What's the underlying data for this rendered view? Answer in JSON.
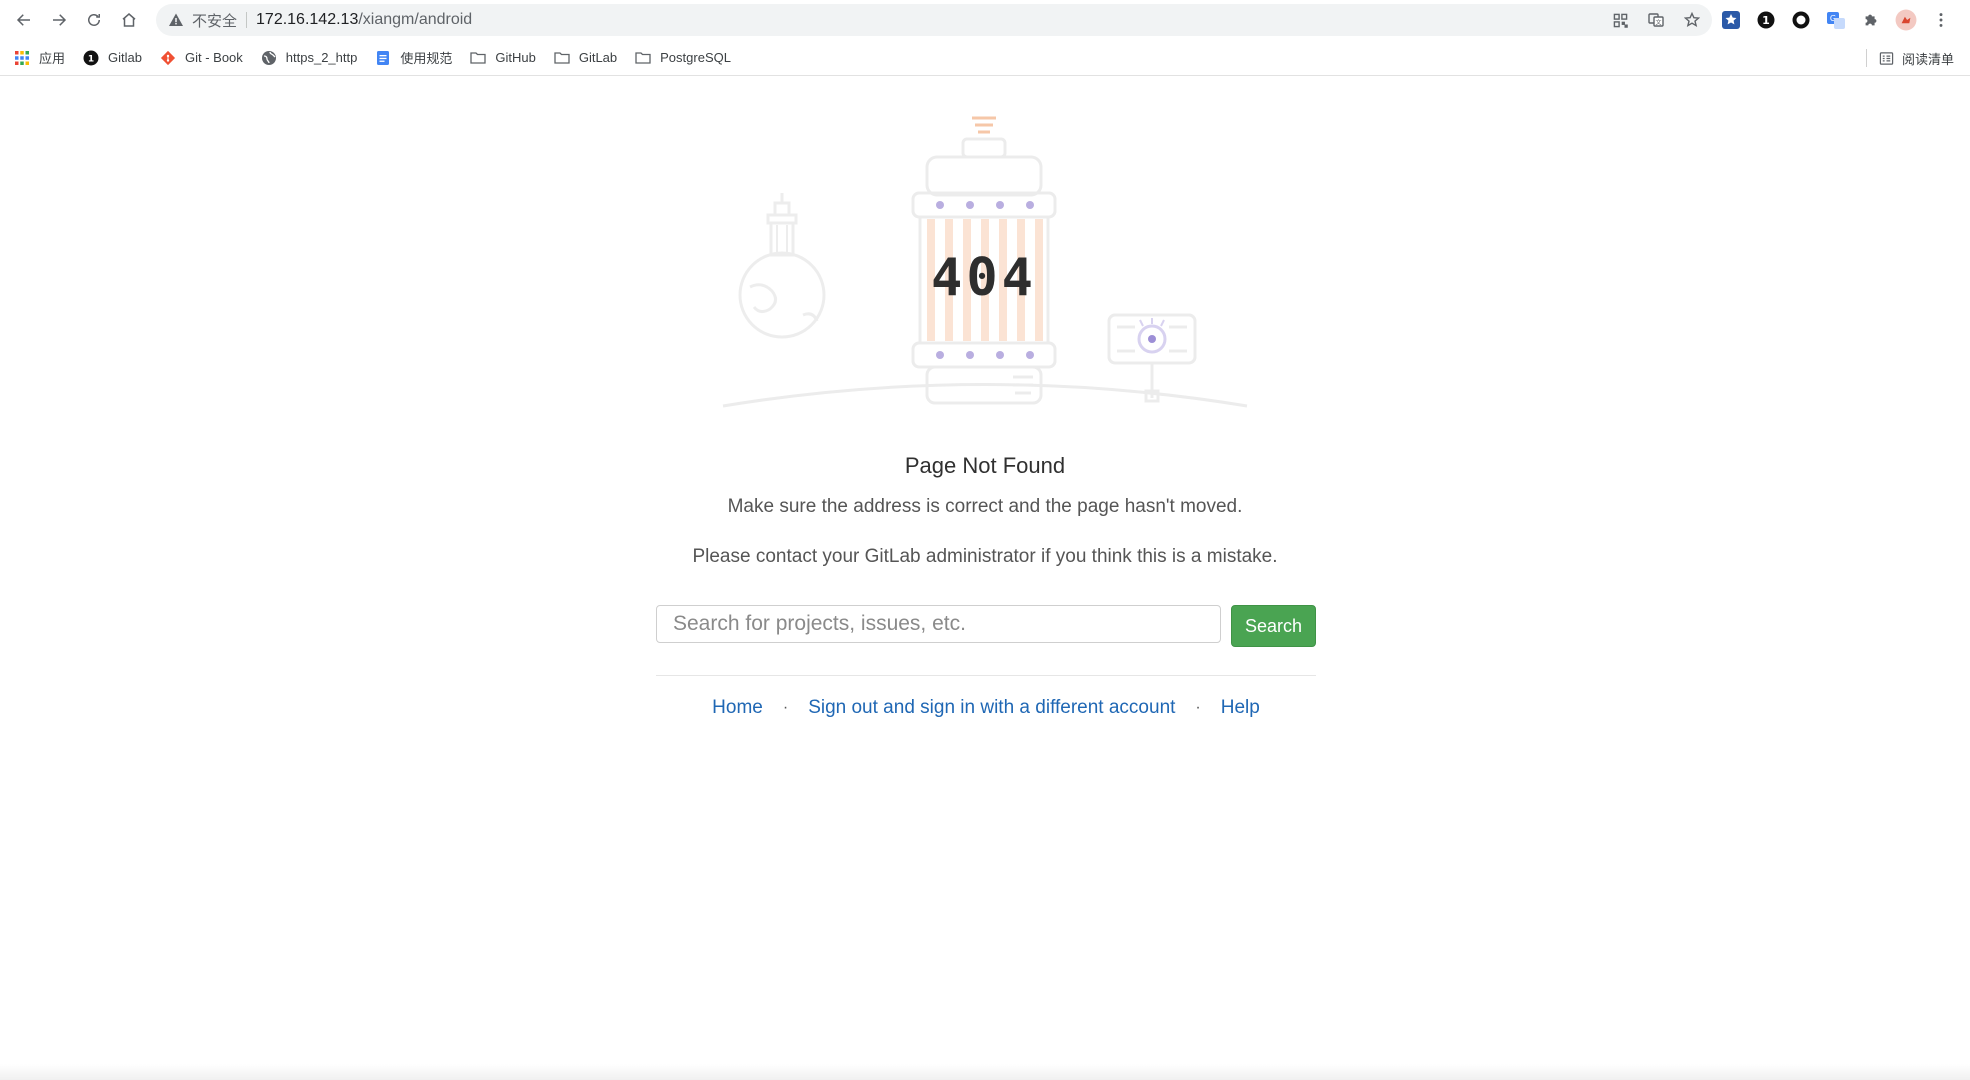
{
  "browser": {
    "insecure_label": "不安全",
    "url_host": "172.16.142.13",
    "url_path": "/xiangm/android",
    "bookmarks": [
      {
        "label": "应用",
        "icon": "apps-grid-icon"
      },
      {
        "label": "Gitlab",
        "icon": "number-one-badge-icon"
      },
      {
        "label": "Git - Book",
        "icon": "git-logo-icon"
      },
      {
        "label": "https_2_http",
        "icon": "globe-icon"
      },
      {
        "label": "使用规范",
        "icon": "doc-icon"
      },
      {
        "label": "GitHub",
        "icon": "folder-icon"
      },
      {
        "label": "GitLab",
        "icon": "folder-icon"
      },
      {
        "label": "PostgreSQL",
        "icon": "folder-icon"
      }
    ],
    "reading_list_label": "阅读清单"
  },
  "error_page": {
    "code": "404",
    "title": "Page Not Found",
    "message_1": "Make sure the address is correct and the page hasn't moved.",
    "message_2": "Please contact your GitLab administrator if you think this is a mistake.",
    "search_placeholder": "Search for projects, issues, etc.",
    "search_button": "Search",
    "links": {
      "home": "Home",
      "sign_out": "Sign out and sign in with a different account",
      "help": "Help",
      "separator": "·"
    }
  },
  "colors": {
    "accent_green": "#4aa452",
    "link_blue": "#1f67b4",
    "illustration_orange": "#f6c7a8",
    "illustration_purple": "#b9aee0"
  }
}
